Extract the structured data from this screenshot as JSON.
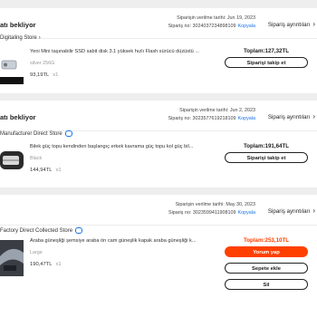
{
  "orders": [
    {
      "status": "atı bekliyor",
      "date_line": "Siparişin verilme tarihi: Jun 19, 2023",
      "order_no": "Sipariş no: 3024037234898109",
      "copy_label": "Kopyala",
      "details_label": "Sipariş ayrıntıları",
      "store": "Digitaling Store",
      "title": "Yeni Mini taşınabilir SSD sabit disk 3.1 yüksek hızlı Flash sürücü düzüstü ...",
      "variant": "silver 256G",
      "price": "93,19TL",
      "qty": "x1",
      "total": "Toplam:127,32TL",
      "buttons": [
        "Siparişi takip et"
      ]
    },
    {
      "status": "atı bekliyor",
      "date_line": "Siparişin verilme tarihi: Jun 2, 2023",
      "order_no": "Sipariş no: 3023577619218109",
      "copy_label": "Kopyala",
      "details_label": "Sipariş ayrıntıları",
      "store": "Manufacturer Direct Store",
      "title": "Bilek güç topu kendinden başlangıç erkek kavrama güç topu kol güç bil...",
      "variant": "Black",
      "price": "144,94TL",
      "qty": "x1",
      "total": "Toplam:191,64TL",
      "buttons": [
        "Siparişi takip et"
      ]
    },
    {
      "status": "",
      "date_line": "Siparişin verilme tarihi: May 30, 2023",
      "order_no": "Sipariş no: 3023599411908109",
      "copy_label": "Kopyala",
      "details_label": "Sipariş ayrıntıları",
      "store": "Factory Direct Collected Store",
      "title": "Araba güneşliği şemsiye araba ön cam güneşlik kapak araba güneşliği k...",
      "variant": "Large",
      "price": "190,47TL",
      "qty": "x1",
      "total": "Toplam:253,10TL",
      "buttons": [
        "Yorum yap",
        "Sepete ekle",
        "Sil"
      ]
    }
  ],
  "colors": {
    "accent": "#ff4000",
    "link": "#1a73e8"
  }
}
